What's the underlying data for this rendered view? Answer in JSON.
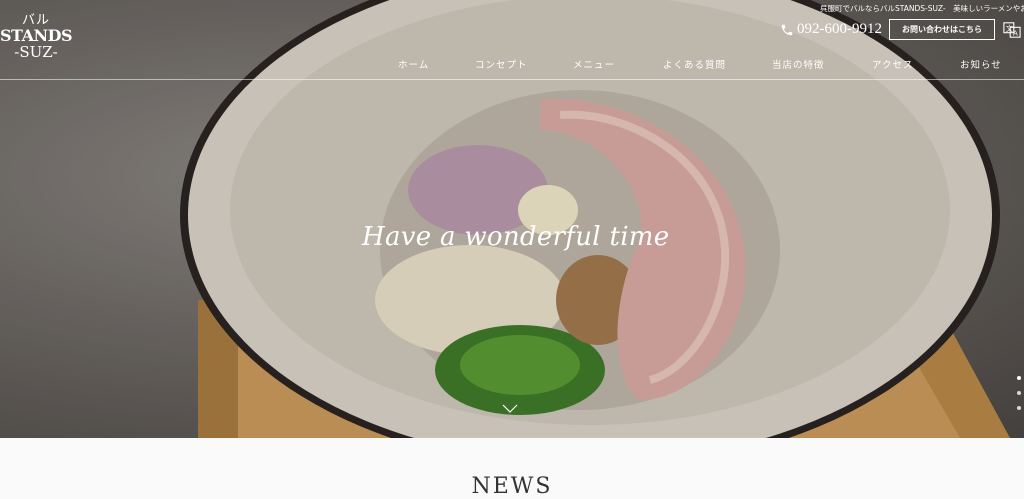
{
  "site": {
    "logo": {
      "kana": "バル",
      "name": "STANDS",
      "suffix": "-SUZ-"
    },
    "tagline": "呉服町でバルならバルSTANDS-SUZ-　美味しいラーメンやお酒"
  },
  "header": {
    "phone": "092-600-9912",
    "contact_label": "お問い合わせはこちら",
    "lang_icon": "translate-icon"
  },
  "nav": {
    "items": [
      {
        "label": "ホーム"
      },
      {
        "label": "コンセプト"
      },
      {
        "label": "メニュー"
      },
      {
        "label": "よくある質問"
      },
      {
        "label": "当店の特徴"
      },
      {
        "label": "アクセス"
      },
      {
        "label": "お知らせ"
      }
    ]
  },
  "hero": {
    "headline": "Have a wonderful time",
    "scroll_icon": "chevron-down-icon",
    "slides": {
      "count": 3,
      "active": 1
    }
  },
  "news": {
    "title": "NEWS"
  },
  "colors": {
    "text_on_hero": "#ffffff",
    "page_bg": "#fafafa"
  }
}
